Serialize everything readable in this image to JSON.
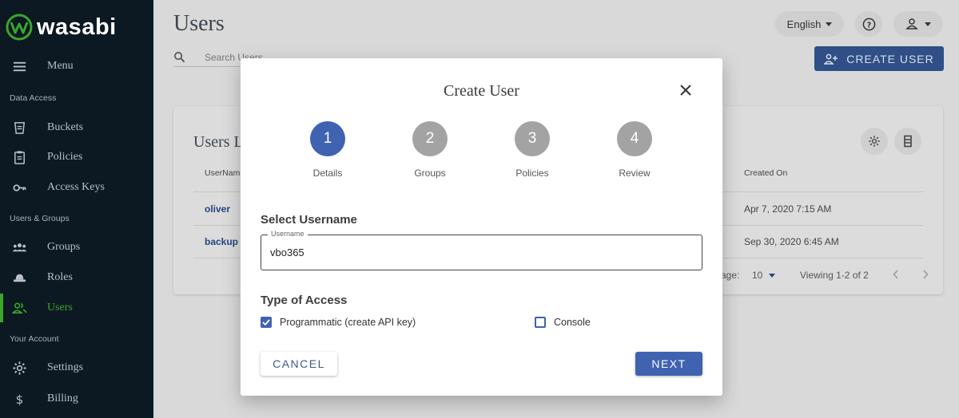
{
  "brand": {
    "name": "wasabi",
    "accent": "#3aa72c"
  },
  "sidebar": {
    "menu_label": "Menu",
    "sections": {
      "data_access": "Data Access",
      "users_groups": "Users & Groups",
      "your_account": "Your Account"
    },
    "items": [
      {
        "label": "Buckets",
        "icon": "bucket-icon"
      },
      {
        "label": "Policies",
        "icon": "clipboard-icon"
      },
      {
        "label": "Access Keys",
        "icon": "key-icon"
      },
      {
        "label": "Groups",
        "icon": "groups-icon"
      },
      {
        "label": "Roles",
        "icon": "hat-icon"
      },
      {
        "label": "Users",
        "icon": "users-icon",
        "active": true
      },
      {
        "label": "Settings",
        "icon": "gear-icon"
      },
      {
        "label": "Billing",
        "icon": "dollar-icon"
      }
    ]
  },
  "header": {
    "title": "Users",
    "search_placeholder": "Search Users",
    "language": "English",
    "create_user_label": "CREATE USER"
  },
  "users_card": {
    "title": "Users L",
    "columns": {
      "username": "UserName",
      "created_on": "Created On"
    },
    "rows": [
      {
        "username": "oliver",
        "created_on": "Apr 7, 2020 7:15 AM"
      },
      {
        "username": "backup",
        "created_on": "Sep 30, 2020 6:45 AM"
      }
    ],
    "rows_per_page_label": "age:",
    "rows_per_page": "10",
    "viewing": "Viewing 1-2 of 2"
  },
  "modal": {
    "title": "Create User",
    "steps": [
      {
        "num": "1",
        "label": "Details",
        "active": true
      },
      {
        "num": "2",
        "label": "Groups"
      },
      {
        "num": "3",
        "label": "Policies"
      },
      {
        "num": "4",
        "label": "Review"
      }
    ],
    "select_username_label": "Select Username",
    "username_field_label": "Username",
    "username_value": "vbo365",
    "type_of_access_label": "Type of Access",
    "programmatic_label": "Programmatic (create API key)",
    "programmatic_checked": true,
    "console_label": "Console",
    "console_checked": false,
    "cancel_label": "CANCEL",
    "next_label": "NEXT",
    "primary_color": "#3f62b1"
  }
}
